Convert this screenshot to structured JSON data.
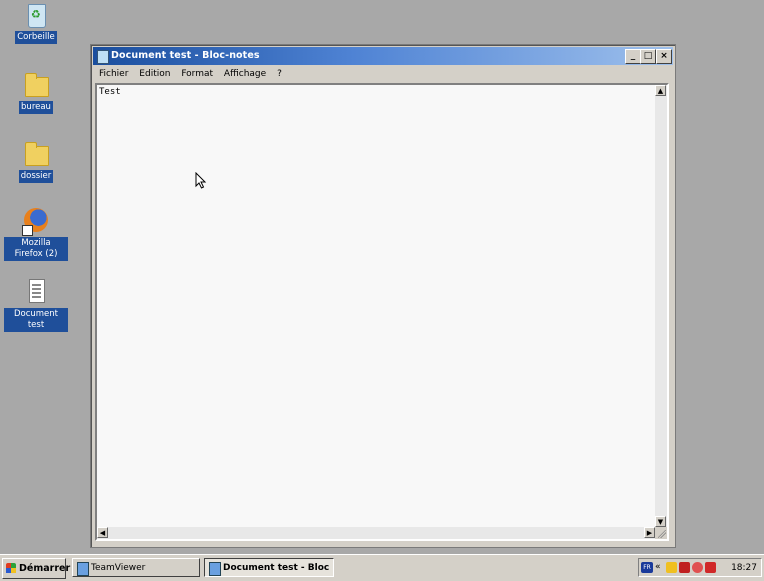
{
  "desktop": {
    "icons": [
      {
        "label": "Corbeille",
        "icon": "recycle-bin-icon"
      },
      {
        "label": "bureau",
        "icon": "folder-icon"
      },
      {
        "label": "dossier",
        "icon": "folder-icon"
      },
      {
        "label": "Mozilla Firefox (2)",
        "icon": "firefox-icon"
      },
      {
        "label": "Document test",
        "icon": "text-document-icon"
      }
    ]
  },
  "window": {
    "title": "Document test - Bloc-notes",
    "controls": {
      "minimize": "_",
      "maximize": "□",
      "close": "×"
    },
    "menu": [
      "Fichier",
      "Edition",
      "Format",
      "Affichage",
      "?"
    ],
    "content": "Test"
  },
  "taskbar": {
    "start_label": "Démarrer",
    "tasks": [
      {
        "label": "TeamViewer",
        "active": false
      },
      {
        "label": "Document test - Bloc ...",
        "active": true
      }
    ],
    "tray": {
      "language": "FR",
      "clock": "18:27"
    }
  }
}
